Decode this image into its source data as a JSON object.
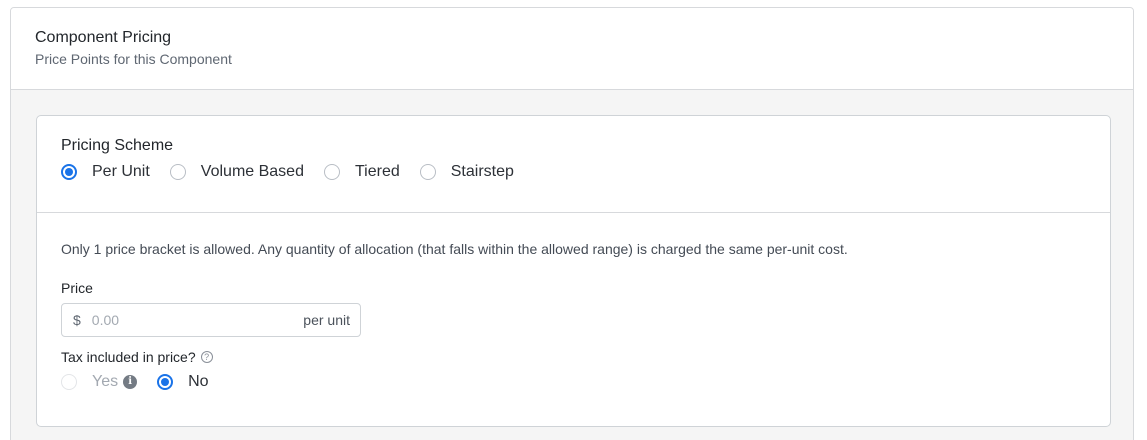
{
  "panel": {
    "title": "Component Pricing",
    "subtitle": "Price Points for this Component"
  },
  "pricing_scheme": {
    "label": "Pricing Scheme",
    "options": [
      {
        "label": "Per Unit",
        "selected": true
      },
      {
        "label": "Volume Based",
        "selected": false
      },
      {
        "label": "Tiered",
        "selected": false
      },
      {
        "label": "Stairstep",
        "selected": false
      }
    ]
  },
  "description": "Only 1 price bracket is allowed. Any quantity of allocation (that falls within the allowed range) is charged the same per-unit cost.",
  "price": {
    "label": "Price",
    "prefix": "$",
    "placeholder": "0.00",
    "value": "",
    "suffix": "per unit"
  },
  "tax": {
    "label": "Tax included in price?",
    "help_icon": "question-circle-icon",
    "options": [
      {
        "label": "Yes",
        "selected": false,
        "disabled": true,
        "icon": "info-circle-icon"
      },
      {
        "label": "No",
        "selected": true,
        "disabled": false
      }
    ]
  },
  "colors": {
    "accent": "#1a73e8",
    "border": "#d7d9dc",
    "panel_bg": "#f5f5f5"
  }
}
